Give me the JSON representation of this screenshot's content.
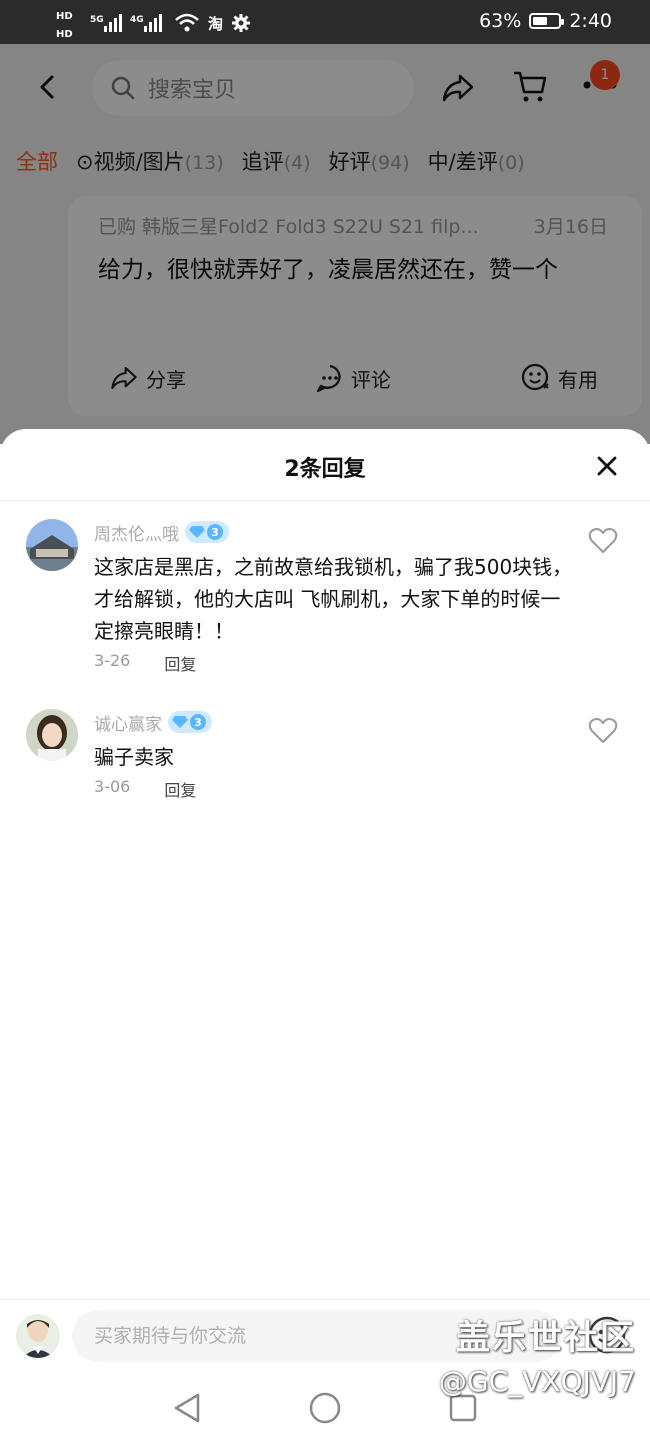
{
  "status_bar": {
    "left_icons_text": "HD 5G 4G 淘",
    "battery": "63%",
    "battery_level": 0.63,
    "time": "2:40"
  },
  "top_bar": {
    "search_placeholder": "搜索宝贝",
    "cart_badge": "1",
    "icons": [
      "back-icon",
      "search-icon",
      "share-icon",
      "cart-icon",
      "more-icon"
    ]
  },
  "filters": [
    {
      "label": "全部",
      "count": "",
      "active": true
    },
    {
      "label": "⊙视频/图片",
      "count": "(13)"
    },
    {
      "label": "追评",
      "count": "(4)"
    },
    {
      "label": "好评",
      "count": "(94)"
    },
    {
      "label": "中/差评",
      "count": "(0)"
    }
  ],
  "review": {
    "purchased": "已购 韩版三星Fold2 Fold3 S22U S21 filp...",
    "date": "3月16日",
    "text": "给力，很快就弄好了，凌晨居然还在，赞一个",
    "actions": {
      "share": "分享",
      "comment": "评论",
      "useful": "有用"
    }
  },
  "sheet": {
    "title": "2条回复",
    "replies": [
      {
        "user": "周杰伦灬哦",
        "level": "3",
        "text": "这家店是黑店，之前故意给我锁机，骗了我500块钱，才给解锁，他的大店叫 飞帆刷机，大家下单的时候一定擦亮眼睛！！",
        "date": "3-26",
        "reply_label": "回复"
      },
      {
        "user": "诚心赢家",
        "level": "3",
        "text": "骗子卖家",
        "date": "3-06",
        "reply_label": "回复"
      }
    ]
  },
  "input": {
    "placeholder": "买家期待与你交流"
  },
  "watermark": {
    "title": "盖乐世社区",
    "handle": "@GC_VXQJVJ7"
  },
  "colors": {
    "accent": "#ff5a1f",
    "badge": "#ff4a1f",
    "level_badge": "#5ab6ff"
  }
}
